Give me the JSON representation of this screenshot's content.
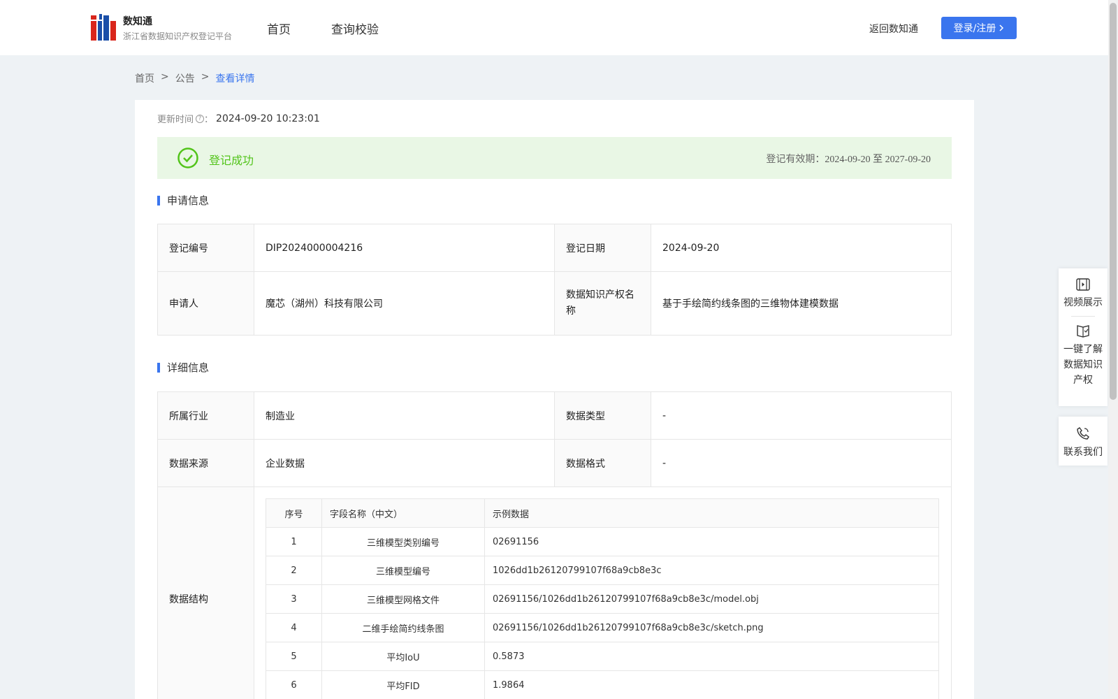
{
  "header": {
    "brand_name": "数知通",
    "brand_sub": "浙江省数据知识产权登记平台",
    "nav": [
      "首页",
      "查询校验"
    ],
    "back_link": "返回数知通",
    "login_label": "登录/注册"
  },
  "breadcrumb": [
    "首页",
    ">",
    "公告",
    ">",
    "查看详情"
  ],
  "update": {
    "label": "更新时间",
    "colon": "：",
    "value": "2024-09-20 10:23:01"
  },
  "status": {
    "text": "登记成功",
    "validity_label": "登记有效期：",
    "validity_dates": "2024-09-20 至 2027-09-20",
    "color": "#52c41a"
  },
  "application": {
    "title": "申请信息",
    "reg_no_label": "登记编号",
    "reg_no": "DIP2024000004216",
    "reg_date_label": "登记日期",
    "reg_date": "2024-09-20",
    "applicant_label": "申请人",
    "applicant": "魔芯（湖州）科技有限公司",
    "ip_name_label": "数据知识产权名称",
    "ip_name": "基于手绘简约线条图的三维物体建模数据"
  },
  "details": {
    "title": "详细信息",
    "industry_label": "所属行业",
    "industry": "制造业",
    "data_type_label": "数据类型",
    "data_type": "-",
    "source_label": "数据来源",
    "source": "企业数据",
    "format_label": "数据格式",
    "format": "-",
    "structure_label": "数据结构",
    "structure": {
      "headers": [
        "序号",
        "字段名称（中文）",
        "示例数据"
      ],
      "rows": [
        {
          "seq": "1",
          "name": "三维模型类别编号",
          "sample": "02691156"
        },
        {
          "seq": "2",
          "name": "三维模型编号",
          "sample": "1026dd1b26120799107f68a9cb8e3c"
        },
        {
          "seq": "3",
          "name": "三维模型网格文件",
          "sample": "02691156/1026dd1b26120799107f68a9cb8e3c/model.obj"
        },
        {
          "seq": "4",
          "name": "二维手绘简约线条图",
          "sample": "02691156/1026dd1b26120799107f68a9cb8e3c/sketch.png"
        },
        {
          "seq": "5",
          "name": "平均IoU",
          "sample": "0.5873"
        },
        {
          "seq": "6",
          "name": "平均FID",
          "sample": "1.9864"
        }
      ]
    }
  },
  "side_panel": {
    "video": "视频展示",
    "learn": "一键了解数据知识产权",
    "contact": "联系我们"
  },
  "colors": {
    "accent": "#3a75ee",
    "success_bg": "#e9f7e5"
  },
  "icons": [
    "logo-icon",
    "help-icon",
    "check-circle-icon",
    "chevron-right-icon",
    "video-icon",
    "book-icon",
    "phone-icon"
  ]
}
